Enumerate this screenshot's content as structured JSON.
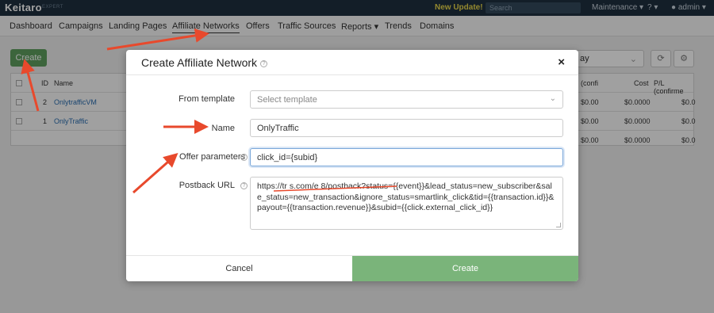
{
  "topbar": {
    "logo": "Keitaro",
    "logo_sub": "EXPERT",
    "new_update": "New Update!",
    "search_placeholder": "Search",
    "maintenance": "Maintenance ▾",
    "help": "? ▾",
    "user": "admin ▾"
  },
  "nav": {
    "items": [
      "Dashboard",
      "Campaigns",
      "Landing Pages",
      "Affiliate Networks",
      "Offers",
      "Traffic Sources",
      "Reports ▾",
      "Trends",
      "Domains"
    ]
  },
  "page": {
    "create_button": "Create",
    "select_value": "ay",
    "table": {
      "headers": [
        "ID",
        "Name"
      ],
      "right_headers": [
        "(confi",
        "Cost",
        "P/L (confirme"
      ],
      "rows": [
        {
          "id": "2",
          "name": "OnlytrafficVM",
          "r1": "$0.00",
          "r2": "$0.0000",
          "r3": "$0.0"
        },
        {
          "id": "1",
          "name": "OnlyTraffic",
          "r1": "$0.00",
          "r2": "$0.0000",
          "r3": "$0.0"
        }
      ],
      "total": {
        "r1": "$0.00",
        "r2": "$0.0000",
        "r3": "$0.0"
      }
    }
  },
  "modal": {
    "title": "Create Affiliate Network",
    "close": "×",
    "from_template_label": "From template",
    "from_template_placeholder": "Select template",
    "name_label": "Name",
    "name_value": "OnlyTraffic",
    "offer_params_label": "Offer parameters",
    "offer_params_value": "click_id={subid}",
    "postback_label": "Postback URL",
    "postback_value": "https://tr            s.com/e        8/postback?status={{event}}&lead_status=new_subscriber&sale_status=new_transaction&ignore_status=smartlink_click&tid={{transaction.id}}&payout={{transaction.revenue}}&subid={{click.external_click_id}}",
    "cancel": "Cancel",
    "create": "Create"
  },
  "colors": {
    "topbar": "#1f2f3f",
    "accent_green": "#7ab47a",
    "annotation_arrow": "#e8492c"
  }
}
